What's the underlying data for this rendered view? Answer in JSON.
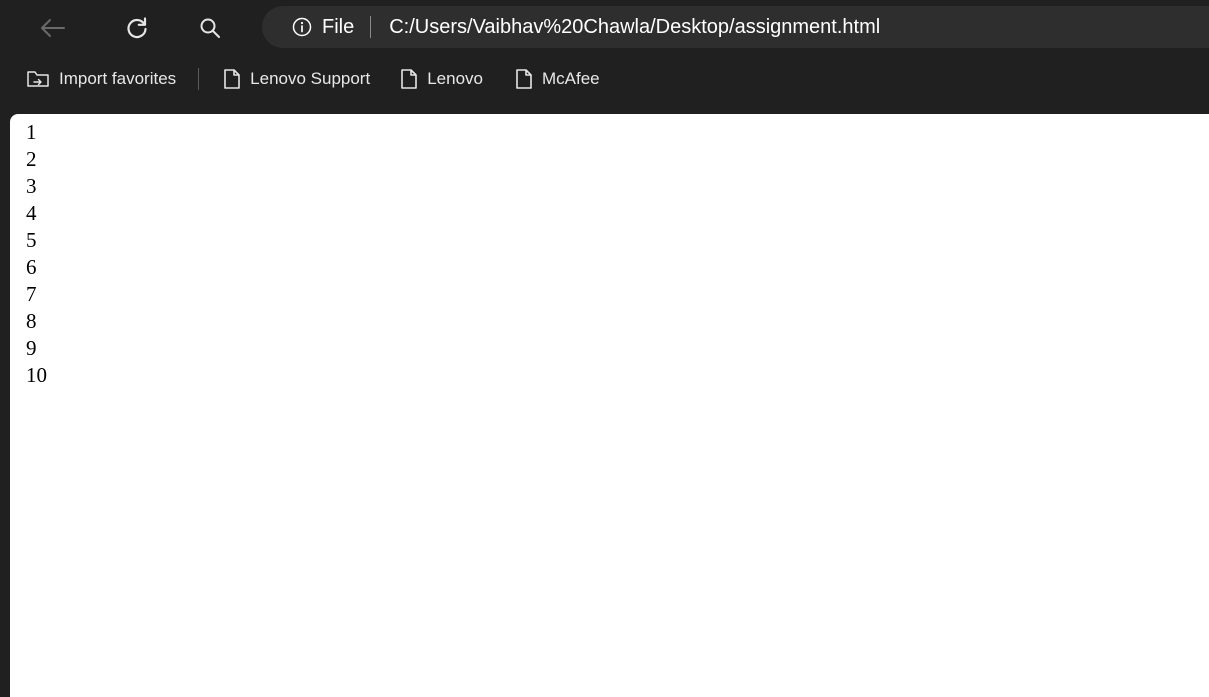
{
  "toolbar": {
    "back_icon": "arrow-left-icon",
    "refresh_icon": "refresh-icon",
    "search_icon": "search-icon"
  },
  "address_bar": {
    "info_icon": "info-icon",
    "scheme": "File",
    "url": "C:/Users/Vaibhav%20Chawla/Desktop/assignment.html"
  },
  "bookmarks": [
    {
      "label": "Import favorites",
      "icon": "import-favorites-icon"
    },
    {
      "label": "Lenovo Support",
      "icon": "page-icon"
    },
    {
      "label": "Lenovo",
      "icon": "page-icon"
    },
    {
      "label": "McAfee",
      "icon": "page-icon"
    }
  ],
  "page": {
    "lines": [
      "1",
      "2",
      "3",
      "4",
      "5",
      "6",
      "7",
      "8",
      "9",
      "10"
    ]
  }
}
